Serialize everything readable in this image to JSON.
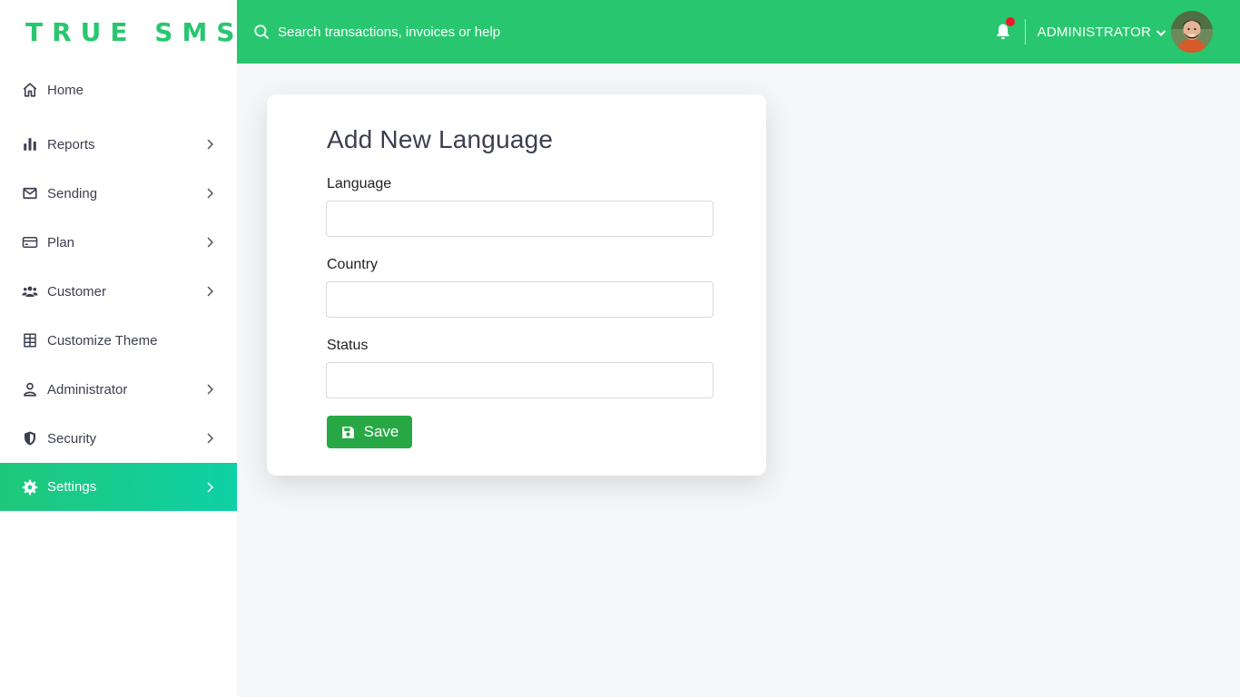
{
  "brand": {
    "name": "TRUE SMS",
    "color": "#28c76f"
  },
  "topbar": {
    "search_placeholder": "Search transactions, invoices or help",
    "user_label": "ADMINISTRATOR",
    "accent": "#28c76f",
    "notification_dot_color": "#ea1a2b"
  },
  "sidebar": {
    "items": [
      {
        "label": "Home",
        "icon": "home-icon",
        "has_submenu": false
      },
      {
        "label": "Reports",
        "icon": "bar-chart-icon",
        "has_submenu": true
      },
      {
        "label": "Sending",
        "icon": "mail-icon",
        "has_submenu": true
      },
      {
        "label": "Plan",
        "icon": "credit-card-icon",
        "has_submenu": true
      },
      {
        "label": "Customer",
        "icon": "users-icon",
        "has_submenu": true
      },
      {
        "label": "Customize Theme",
        "icon": "grid-icon",
        "has_submenu": false
      },
      {
        "label": "Administrator",
        "icon": "user-icon",
        "has_submenu": true
      },
      {
        "label": "Security",
        "icon": "shield-icon",
        "has_submenu": true
      },
      {
        "label": "Settings",
        "icon": "gear-icon",
        "has_submenu": true,
        "active": true
      }
    ]
  },
  "form": {
    "title": "Add New Language",
    "fields": [
      {
        "label": "Language",
        "value": ""
      },
      {
        "label": "Country",
        "value": ""
      },
      {
        "label": "Status",
        "value": ""
      }
    ],
    "save_label": "Save",
    "save_color": "#28a745"
  }
}
